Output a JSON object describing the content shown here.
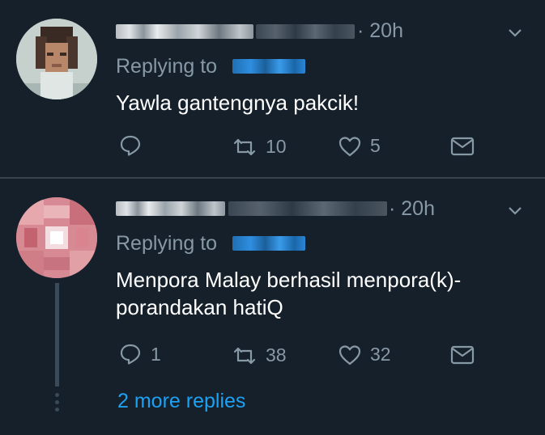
{
  "tweets": [
    {
      "time": "· 20h",
      "replying_to": "Replying to",
      "text": "Yawla gantengnya pakcik!",
      "reply_count": "",
      "retweet_count": "10",
      "like_count": "5"
    },
    {
      "time": "· 20h",
      "replying_to": "Replying to",
      "text": "Menpora Malay berhasil menpora(k)-\nporandakan hatiQ",
      "reply_count": "1",
      "retweet_count": "38",
      "like_count": "32"
    }
  ],
  "more_replies": "2 more replies",
  "icons": {
    "reply": "reply-icon",
    "retweet": "retweet-icon",
    "like": "heart-icon",
    "message": "envelope-icon",
    "caret": "chevron-down-icon"
  },
  "colors": {
    "background": "#15202b",
    "divider": "#38444d",
    "secondary_text": "#8899a6",
    "link": "#1da1f2"
  }
}
